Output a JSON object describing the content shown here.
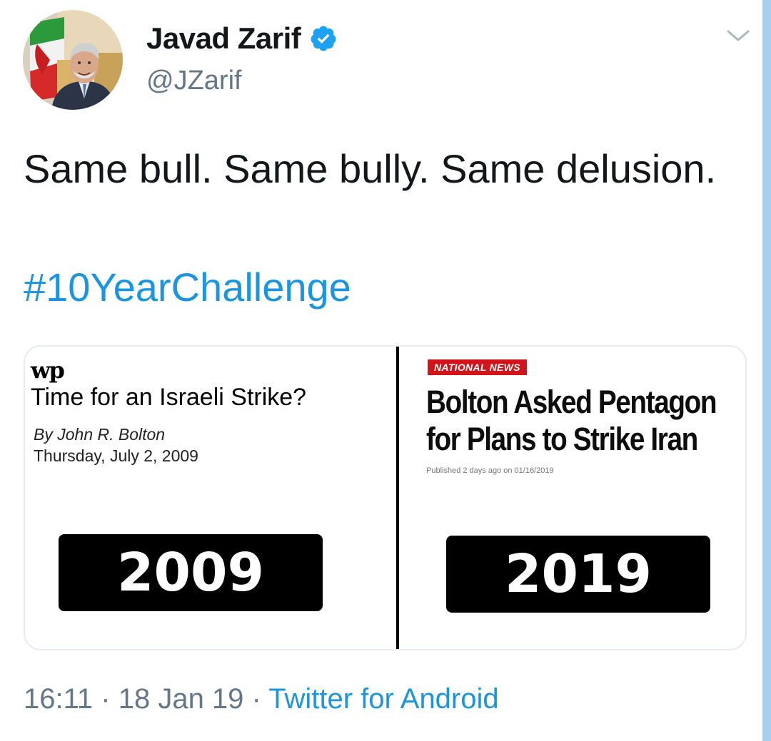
{
  "author": {
    "display_name": "Javad Zarif",
    "handle": "@JZarif",
    "verified": true
  },
  "tweet": {
    "text": "Same bull.  Same bully.  Same delusion.",
    "hashtag": "#10YearChallenge"
  },
  "media": {
    "left": {
      "logo": "wp",
      "headline": "Time for an Israeli Strike?",
      "byline": "By John R. Bolton",
      "date": "Thursday, July 2, 2009",
      "year": "2009"
    },
    "right": {
      "tag": "NATIONAL NEWS",
      "headline_line1": "Bolton Asked Pentagon",
      "headline_line2": "for Plans to Strike Iran",
      "published": "Published 2 days ago on 01/16/2019",
      "year": "2019"
    }
  },
  "meta": {
    "time": "16:11",
    "separator": "·",
    "date": "18 Jan 19",
    "source": "Twitter for Android"
  },
  "colors": {
    "link": "#1b95e0",
    "secondary_text": "#657786",
    "primary_text": "#14171a",
    "news_tag": "#d0141a"
  },
  "icons": {
    "verified": "verified-badge-icon",
    "menu": "chevron-down-icon"
  }
}
